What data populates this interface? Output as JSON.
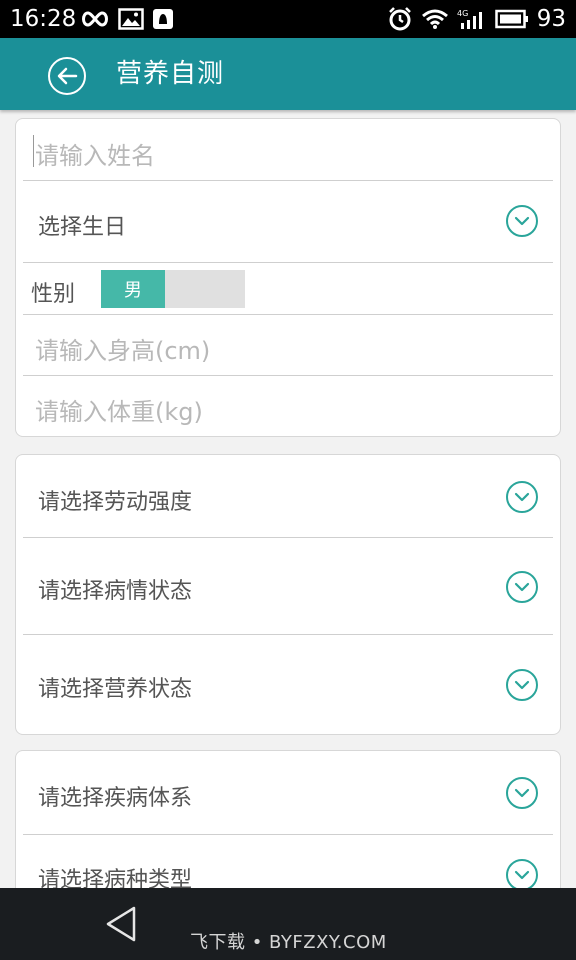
{
  "status_bar": {
    "time": "16:28",
    "battery": "93"
  },
  "app_bar": {
    "title": "营养自测"
  },
  "form": {
    "name_placeholder": "请输入姓名",
    "birthday_label": "选择生日",
    "gender_label": "性别",
    "gender_selected": "男",
    "height_placeholder": "请输入身高(cm)",
    "weight_placeholder": "请输入体重(kg)"
  },
  "selects_1": [
    {
      "label": "请选择劳动强度"
    },
    {
      "label": "请选择病情状态"
    },
    {
      "label": "请选择营养状态"
    }
  ],
  "selects_2": [
    {
      "label": "请选择疾病体系"
    },
    {
      "label": "请选择病种类型"
    }
  ],
  "watermark": "飞下载 • BYFZXY.COM",
  "colors": {
    "primary": "#1b9098",
    "accent": "#2aa59a",
    "toggle_on": "#45b8a8"
  }
}
